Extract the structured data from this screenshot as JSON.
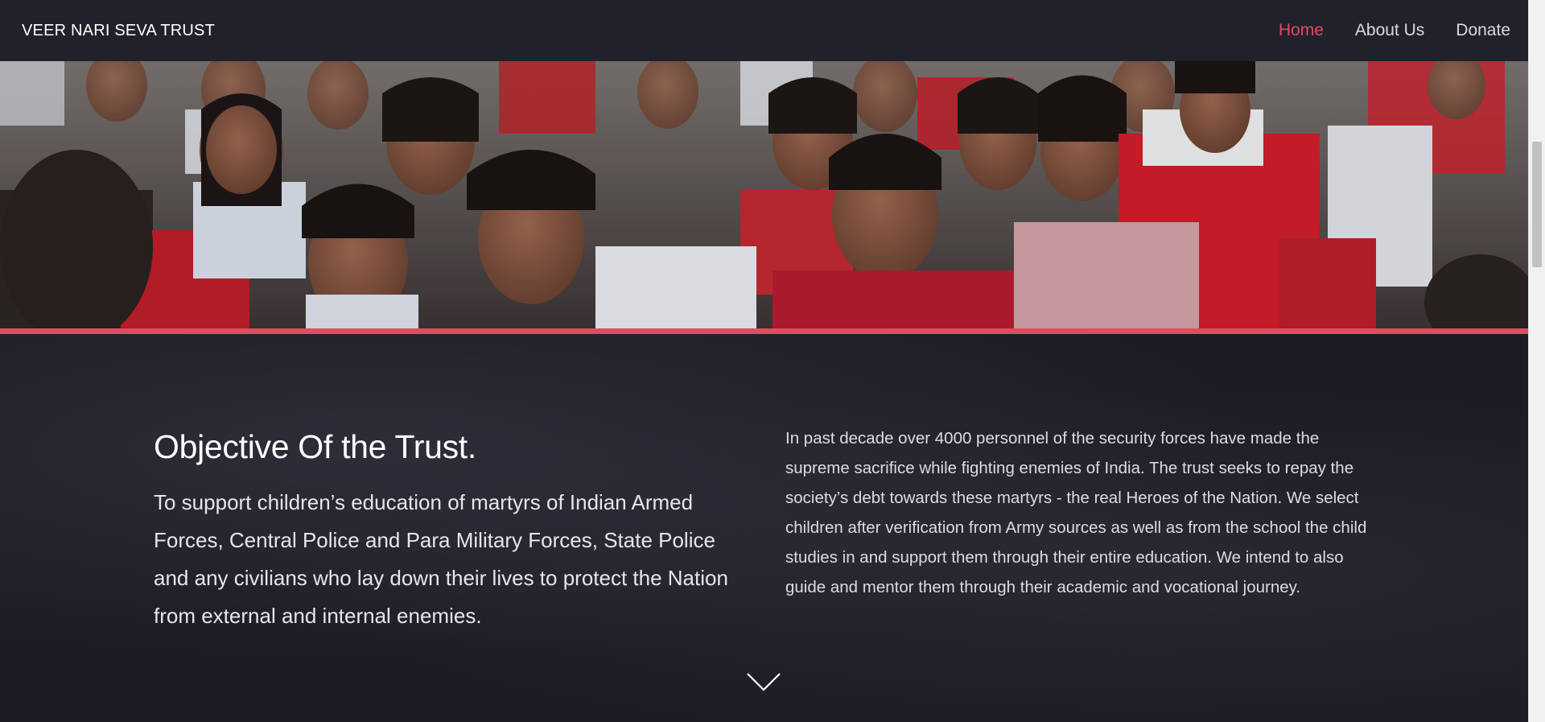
{
  "brand": "VEER NARI SEVA TRUST",
  "nav": {
    "items": [
      {
        "label": "Home",
        "active": true
      },
      {
        "label": "About Us",
        "active": false
      },
      {
        "label": "Donate",
        "active": false
      }
    ]
  },
  "colors": {
    "accent": "#e14b63",
    "nav_background": "#21212c",
    "section_background": "#1d1c25"
  },
  "objective": {
    "heading": "Objective Of the Trust.",
    "text": "To support children’s education of martyrs of Indian Armed Forces, Central Police and Para Military Forces, State Police and any civilians who lay down their lives to protect the Nation from external and internal enemies."
  },
  "description": "In past decade over 4000 personnel of the security forces have made the supreme sacrifice while fighting enemies of India. The trust seeks to repay the society’s debt towards these martyrs - the real Heroes of the Nation. We select children after verification from Army sources as well as from the school the child studies in and support them through their entire education. We intend to also guide and mentor them through their academic and vocational journey.",
  "icons": {
    "scroll_down": "chevron-down-icon"
  }
}
